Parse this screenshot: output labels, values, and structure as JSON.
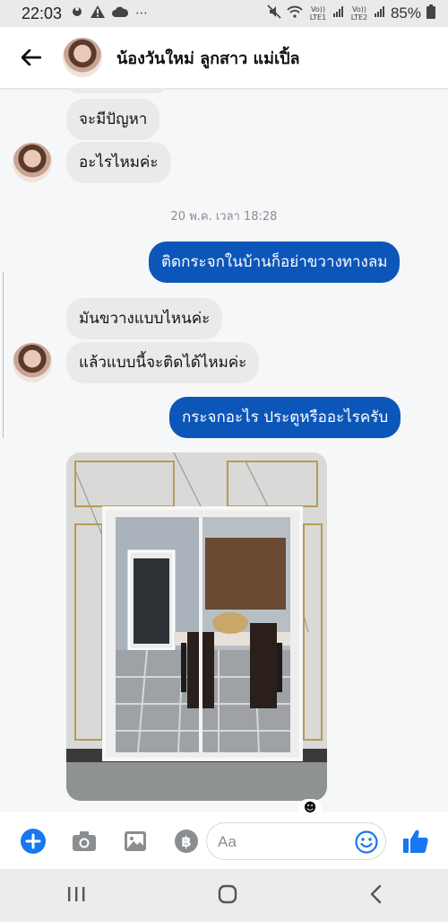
{
  "status_bar": {
    "time": "22:03",
    "battery_percent": "85%",
    "sim1_label": "Vo)) LTE1",
    "sim2_label": "Vo)) LTE2"
  },
  "header": {
    "contact_name": "น้องวันใหม่ ลูกสาว แม่เปิ้ล"
  },
  "messages": [
    {
      "side": "in",
      "text": "จะมีปัญหา"
    },
    {
      "side": "in",
      "text": "อะไรไหมค่ะ"
    },
    {
      "side": "out",
      "text": "ติดกระจกในบ้านก็อย่าขวางทางลม"
    },
    {
      "side": "in",
      "text": "มันขวางแบบไหนค่ะ"
    },
    {
      "side": "in",
      "text": "แล้วแบบนี้จะติดได้ไหมค่ะ"
    },
    {
      "side": "out",
      "text": "กระจกอะไร ประตูหรืออะไรครับ"
    }
  ],
  "timestamp": "20 พ.ค. เวลา 18:28",
  "reaction_label": "+",
  "composer": {
    "placeholder": "Aa"
  },
  "colors": {
    "outgoing_bubble": "#0d56b9",
    "incoming_bubble": "#e9eaec",
    "accent": "#1877f2"
  }
}
